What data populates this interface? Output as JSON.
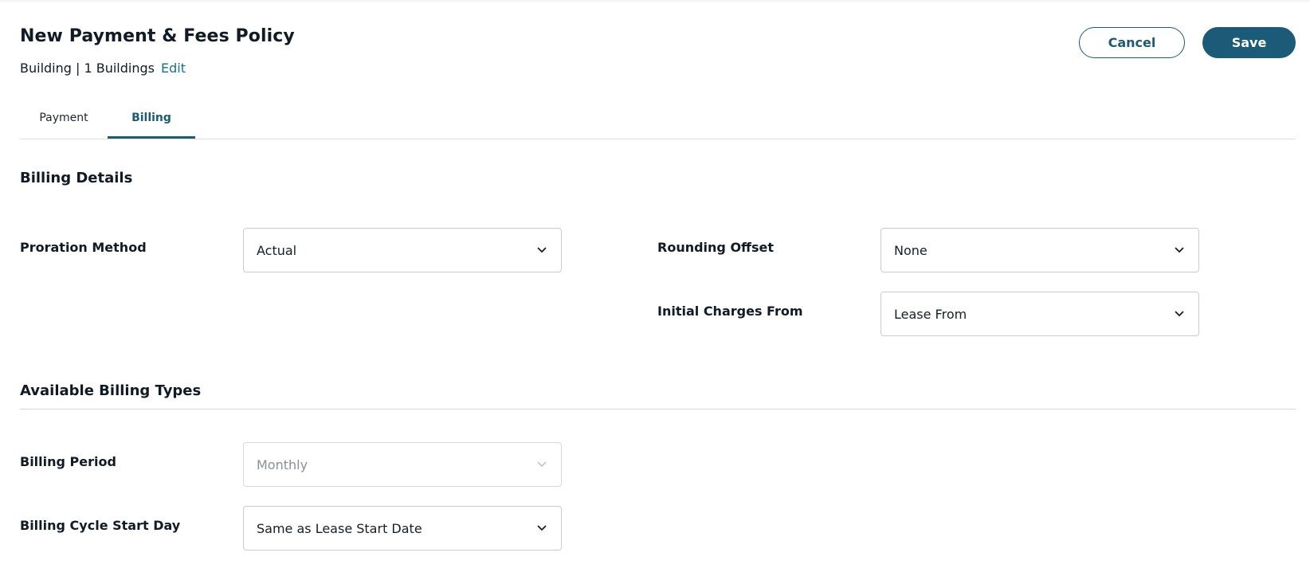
{
  "header": {
    "title": "New Payment & Fees Policy",
    "scope_text": "Building | 1 Buildings",
    "edit_label": "Edit",
    "cancel_label": "Cancel",
    "save_label": "Save"
  },
  "tabs": [
    {
      "label": "Payment",
      "active": false
    },
    {
      "label": "Billing",
      "active": true
    }
  ],
  "billing_details": {
    "title": "Billing Details",
    "proration_method": {
      "label": "Proration Method",
      "value": "Actual"
    },
    "rounding_offset": {
      "label": "Rounding Offset",
      "value": "None"
    },
    "initial_charges_from": {
      "label": "Initial Charges From",
      "value": "Lease From"
    }
  },
  "billing_types": {
    "title": "Available Billing Types",
    "billing_period": {
      "label": "Billing Period",
      "value": "Monthly",
      "disabled": true
    },
    "billing_cycle_start_day": {
      "label": "Billing Cycle Start Day",
      "value": "Same as Lease Start Date"
    }
  },
  "colors": {
    "primary": "#1c5b77",
    "link": "#17708f",
    "disabled_text": "#8a9098"
  },
  "icons": {
    "dropdown": "chevron-down-icon"
  }
}
